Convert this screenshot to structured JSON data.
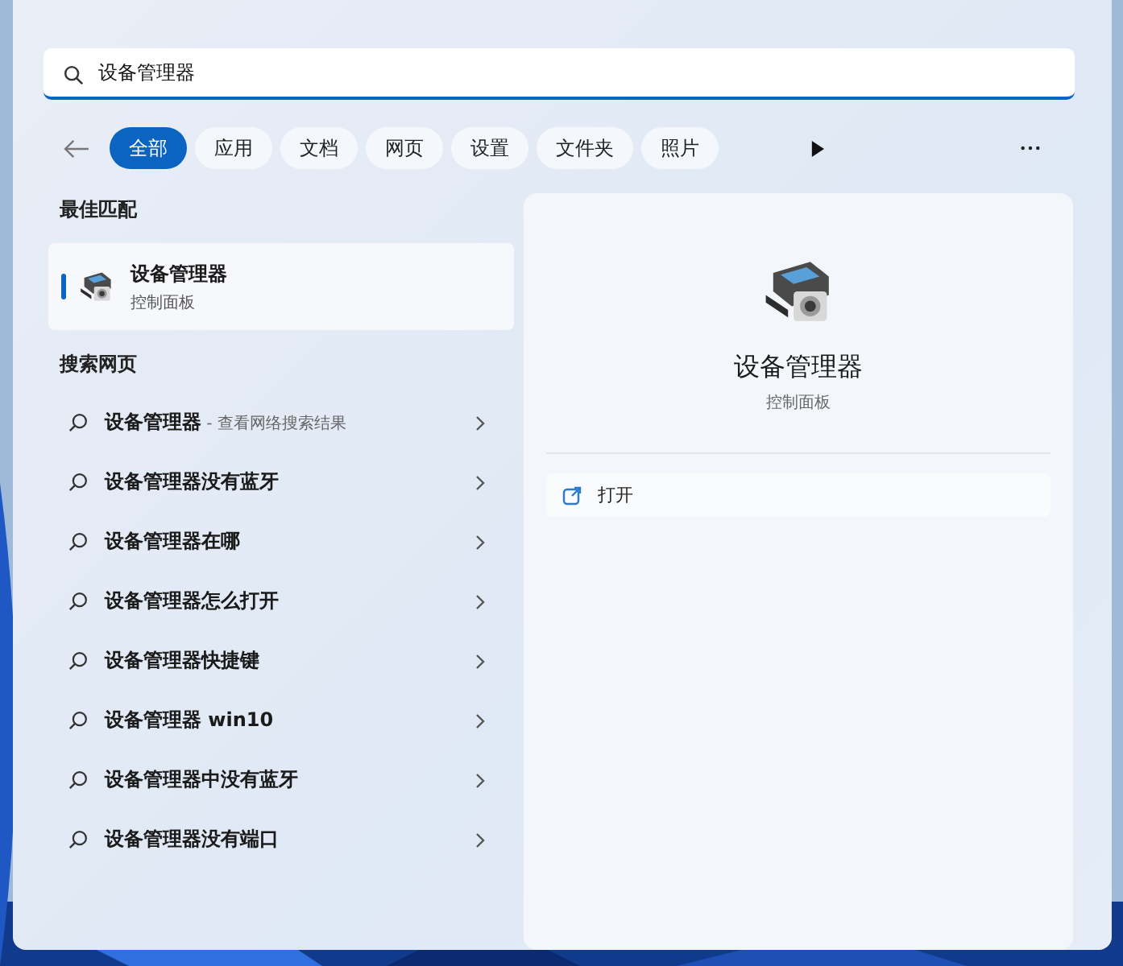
{
  "search": {
    "value": "设备管理器"
  },
  "filters": [
    {
      "label": "全部",
      "selected": true
    },
    {
      "label": "应用",
      "selected": false
    },
    {
      "label": "文档",
      "selected": false
    },
    {
      "label": "网页",
      "selected": false
    },
    {
      "label": "设置",
      "selected": false
    },
    {
      "label": "文件夹",
      "selected": false
    },
    {
      "label": "照片",
      "selected": false
    }
  ],
  "best_match": {
    "heading": "最佳匹配",
    "title": "设备管理器",
    "subtitle": "控制面板",
    "selected": true
  },
  "web_search": {
    "heading": "搜索网页",
    "suggestions": [
      {
        "text": "设备管理器",
        "suffix": "- 查看网络搜索结果"
      },
      {
        "text": "设备管理器没有蓝牙"
      },
      {
        "text": "设备管理器在哪"
      },
      {
        "text": "设备管理器怎么打开"
      },
      {
        "text": "设备管理器快捷键"
      },
      {
        "text": "设备管理器 win10"
      },
      {
        "text": "设备管理器中没有蓝牙"
      },
      {
        "text": "设备管理器没有端口"
      }
    ]
  },
  "detail": {
    "title": "设备管理器",
    "subtitle": "控制面板",
    "actions": [
      {
        "label": "打开"
      }
    ]
  }
}
